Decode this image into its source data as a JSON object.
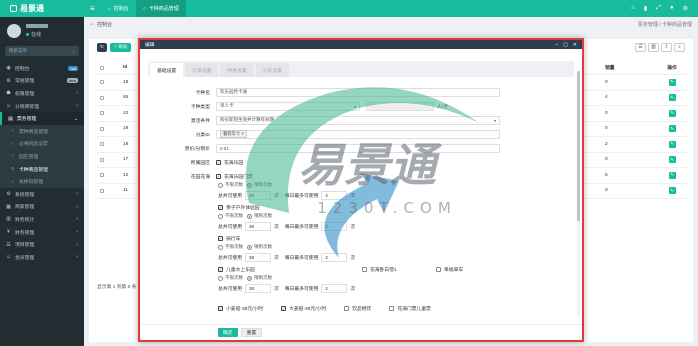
{
  "app": {
    "logo": "易景通",
    "user_status": "在线",
    "search_placeholder": "搜索菜单"
  },
  "top_tabs": [
    {
      "label": "控制台",
      "icon": "dashboard-icon"
    },
    {
      "label": "卡种商品管理",
      "icon": "circle-icon"
    }
  ],
  "sidebar": {
    "items": [
      {
        "label": "控制台",
        "badge": "hot"
      },
      {
        "label": "常规管理",
        "badge": "new"
      },
      {
        "label": "权限管理"
      },
      {
        "label": "分销商管理"
      },
      {
        "label": "票务管理"
      }
    ],
    "sub_items": [
      {
        "label": "票种商品管理"
      },
      {
        "label": "过闸机验证票"
      },
      {
        "label": "园区管理"
      },
      {
        "label": "卡种商品管理"
      },
      {
        "label": "兑换码管理"
      }
    ],
    "items_after": [
      {
        "label": "系统管理"
      },
      {
        "label": "商家管理"
      },
      {
        "label": "财务统计"
      },
      {
        "label": "财务管理"
      },
      {
        "label": "项目管理"
      },
      {
        "label": "会员管理"
      }
    ]
  },
  "breadcrumb": {
    "left": "控制台",
    "right": "票务管理 / 卡种商品管理"
  },
  "toolbar": {
    "add_label": "+ 添加"
  },
  "grid": {
    "headers": {
      "id": "Id",
      "sales": "销量",
      "op": "操作"
    },
    "rows": [
      {
        "id": "18",
        "sales": "0"
      },
      {
        "id": "65",
        "sales": "4"
      },
      {
        "id": "22",
        "sales": "0"
      },
      {
        "id": "19",
        "sales": "0"
      },
      {
        "id": "18",
        "sales": "2"
      },
      {
        "id": "17",
        "sales": "0"
      },
      {
        "id": "12",
        "sales": "5"
      },
      {
        "id": "11",
        "sales": "0"
      }
    ],
    "page_info": "显示第 1 到第 8 条"
  },
  "modal": {
    "title": "编辑",
    "tabs": [
      "基础设置",
      "订单设置",
      "特惠设置",
      "分享设置"
    ],
    "fields": {
      "card_name_label": "卡种名",
      "card_name_value": "欢乐园月卡通",
      "card_type_label": "卡种类型",
      "card_type_value": "单人卡",
      "card_unit": "人/卡",
      "valid_cond_label": "激活条件",
      "valid_cond_value": "购买即刻生效并计算有效期",
      "category_label": "分类ID",
      "category_tag": "暑假年卡",
      "price_label": "原价/分销价",
      "price_value": "0.01",
      "park_label": "所属园区",
      "park_value": "花海乐园",
      "project_label": "花园花海"
    },
    "limits": [
      {
        "name": "花海乐园门票",
        "per_total": "38",
        "per_day": "2"
      },
      {
        "name": "亲子户外体验园",
        "per_total": "38",
        "per_day": "2"
      },
      {
        "name": "骑行车",
        "per_total": "38",
        "per_day": "2"
      },
      {
        "name": "儿童水上乐园",
        "per_total": "38",
        "per_day": "2"
      }
    ],
    "limit_labels": {
      "unlimited": "不限次数",
      "limited": "限制次数",
      "total": "总共可使用",
      "times": "次",
      "daily": "每日最多可使用",
      "times2": "次"
    },
    "extra_items": [
      "花海卧白营1",
      "幸福单车"
    ],
    "bottom_items": [
      "小姜船-38元/小时",
      "大姜船-38元/小时",
      "饮品畅饮",
      "花海门票儿童票"
    ],
    "ok_label": "确定",
    "reset_label": "重置"
  },
  "watermark": {
    "text": "易景通",
    "url": "1230T.COM"
  },
  "colors": {
    "primary": "#18bc9c",
    "sidebar": "#222d32",
    "header": "#2c3e50",
    "highlight": "#e53935"
  }
}
